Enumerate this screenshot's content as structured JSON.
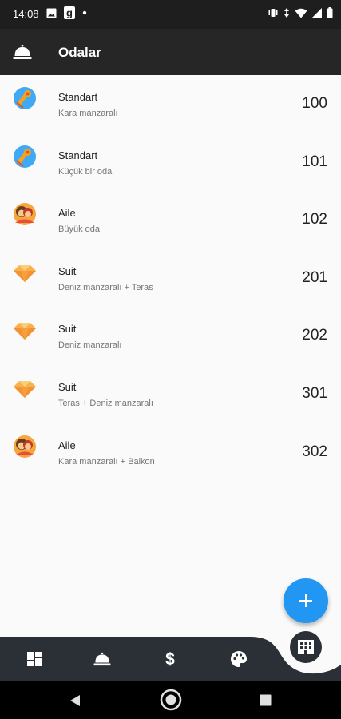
{
  "status_bar": {
    "time": "14:08",
    "left_icons": [
      "image-icon",
      "g-app-icon",
      "dot-icon"
    ],
    "right_icons": [
      "vibrate-icon",
      "data-arrows-icon",
      "wifi-icon",
      "signal-icon",
      "battery-icon"
    ]
  },
  "app_bar": {
    "title": "Odalar",
    "icon": "room-service-bell-icon"
  },
  "rooms": [
    {
      "type": "Standart",
      "description": "Kara manzaralı",
      "number": "100",
      "icon": "bed-icon"
    },
    {
      "type": "Standart",
      "description": "Küçük bir oda",
      "number": "101",
      "icon": "bed-icon"
    },
    {
      "type": "Aile",
      "description": "Büyük oda",
      "number": "102",
      "icon": "family-icon"
    },
    {
      "type": "Suit",
      "description": "Deniz manzaralı + Teras",
      "number": "201",
      "icon": "diamond-icon"
    },
    {
      "type": "Suit",
      "description": "Deniz manzaralı",
      "number": "202",
      "icon": "diamond-icon"
    },
    {
      "type": "Suit",
      "description": "Teras + Deniz manzaralı",
      "number": "301",
      "icon": "diamond-icon"
    },
    {
      "type": "Aile",
      "description": "Kara manzaralı + Balkon",
      "number": "302",
      "icon": "family-icon"
    }
  ],
  "fab": {
    "icon": "plus-icon"
  },
  "bottom_nav": {
    "items": [
      "dashboard-icon",
      "room-service-bell-icon",
      "dollar-icon",
      "palette-icon",
      "hotel-building-icon"
    ],
    "active": "hotel-building-icon"
  },
  "colors": {
    "app_bar": "#262626",
    "status_bar": "#1e1e1e",
    "nav_bar": "#2b3036",
    "fab": "#2196f3",
    "background": "#fafafa"
  }
}
